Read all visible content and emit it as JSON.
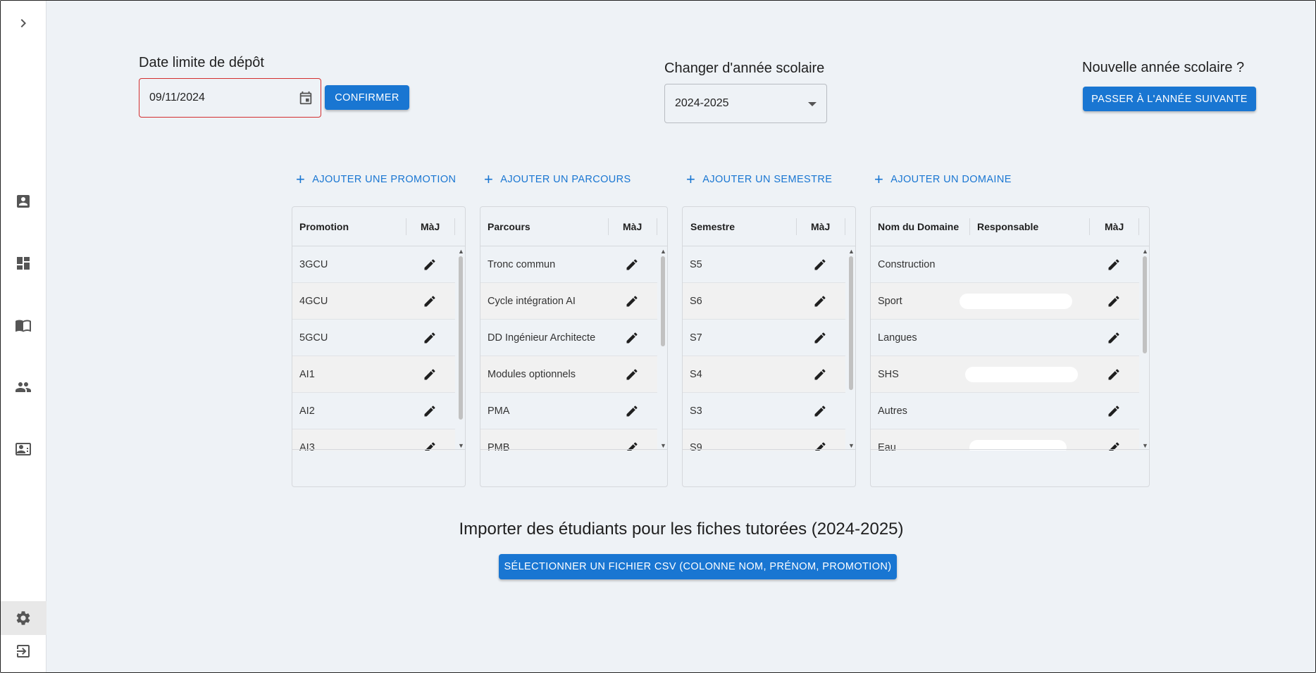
{
  "sidebar": {
    "items": [
      {
        "name": "chevron-right-icon",
        "icon": "chevron-right"
      },
      {
        "name": "contact-card-icon",
        "icon": "account-box"
      },
      {
        "name": "dashboard-icon",
        "icon": "dashboard"
      },
      {
        "name": "book-icon",
        "icon": "menu-book"
      },
      {
        "name": "people-icon",
        "icon": "people"
      },
      {
        "name": "contact-id-icon",
        "icon": "contact-mail"
      },
      {
        "name": "settings-icon",
        "icon": "settings"
      },
      {
        "name": "logout-icon",
        "icon": "logout"
      }
    ]
  },
  "deadline": {
    "label": "Date limite de dépôt",
    "value": "09/11/2024",
    "confirm_label": "CONFIRMER"
  },
  "year_select": {
    "label": "Changer d'année scolaire",
    "value": "2024-2025"
  },
  "new_year": {
    "label": "Nouvelle année scolaire ?",
    "button_label": "PASSER À L'ANNÉE SUIVANTE"
  },
  "promotions": {
    "add_label": "AJOUTER UNE PROMOTION",
    "headers": [
      "Promotion",
      "MàJ"
    ],
    "rows": [
      "3GCU",
      "4GCU",
      "5GCU",
      "AI1",
      "AI2",
      "AI3"
    ]
  },
  "parcours": {
    "add_label": "AJOUTER UN PARCOURS",
    "headers": [
      "Parcours",
      "MàJ"
    ],
    "rows": [
      "Tronc commun",
      "Cycle intégration AI",
      "DD Ingénieur Architecte",
      "Modules optionnels",
      "PMA",
      "PMB"
    ]
  },
  "semestres": {
    "add_label": "AJOUTER UN SEMESTRE",
    "headers": [
      "Semestre",
      "MàJ"
    ],
    "rows": [
      "S5",
      "S6",
      "S7",
      "S4",
      "S3",
      "S9"
    ]
  },
  "domaines": {
    "add_label": "AJOUTER UN DOMAINE",
    "headers": [
      "Nom du Domaine",
      "Responsable",
      "MàJ"
    ],
    "rows": [
      "Construction",
      "Sport",
      "Langues",
      "SHS",
      "Autres",
      "Eau"
    ]
  },
  "import": {
    "title": "Importer des étudiants pour les fiches tutorées (2024-2025)",
    "button_label": "SÉLECTIONNER UN FICHIER CSV (COLONNE NOM, PRÉNOM, PROMOTION)"
  },
  "colors": {
    "primary": "#1976d2",
    "background": "#eef2f6",
    "error_border": "#d32f2f"
  }
}
